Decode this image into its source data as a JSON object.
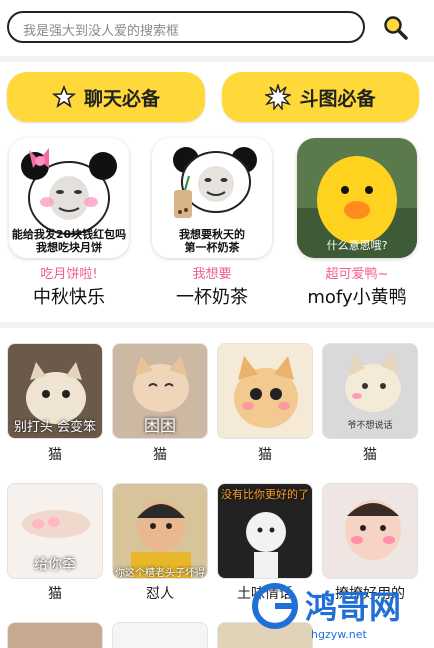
{
  "search": {
    "placeholder": "我是强大到没人爱的搜索框",
    "icon": "search-icon"
  },
  "categories": [
    {
      "label": "聊天必备",
      "icon": "star-outline-icon"
    },
    {
      "label": "斗图必备",
      "icon": "burst-icon"
    }
  ],
  "featured": [
    {
      "caption": "能给我发20块钱红包吗\n我想吃块月饼",
      "subtitle": "吃月饼啦!",
      "title": "中秋快乐"
    },
    {
      "caption": "我想要秋天的\n第一杯奶茶",
      "subtitle": "我想要",
      "title": "一杯奶茶"
    },
    {
      "caption": "什么意思哦?",
      "subtitle": "超可爱鸭~",
      "title": "mofy小黄鸭"
    }
  ],
  "grid_row1": [
    {
      "caption": "别打头 会变笨",
      "label": "猫"
    },
    {
      "caption": "困困",
      "label": "猫"
    },
    {
      "caption": "",
      "label": "猫"
    },
    {
      "caption": "爷不想说话",
      "label": "猫"
    }
  ],
  "grid_row2": [
    {
      "caption": "给你牵",
      "label": "猫"
    },
    {
      "caption": "你这个糟老头子坏得很",
      "label": "怼人"
    },
    {
      "caption": "没有比你更好的了",
      "label": "土味情话"
    },
    {
      "caption": "",
      "label": "撩撩好用的"
    }
  ],
  "watermark": {
    "text": "鸿哥网",
    "url": "hgzyw.net"
  },
  "colors": {
    "accent": "#ffd93a",
    "subtitle": "#f0608a",
    "watermark": "#1f6fd6"
  }
}
